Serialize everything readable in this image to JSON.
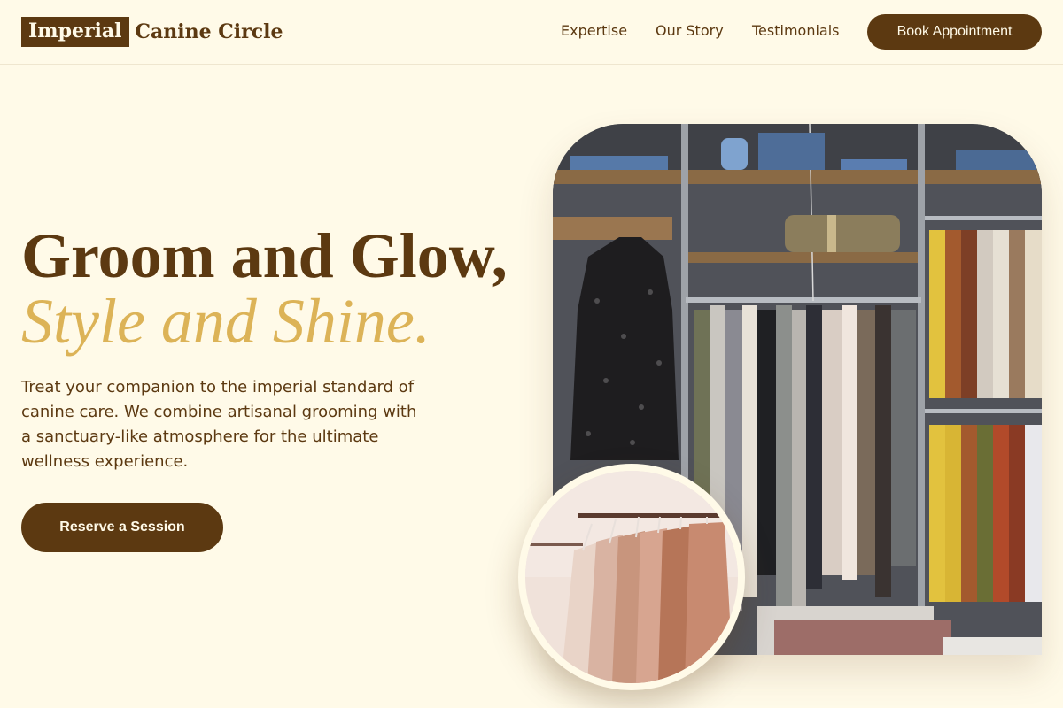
{
  "brand": {
    "highlight": "Imperial",
    "rest": "Canine Circle"
  },
  "nav": {
    "items": [
      "Expertise",
      "Our Story",
      "Testimonials"
    ],
    "cta_label": "Book Appointment"
  },
  "hero": {
    "title_line1": "Groom and Glow,",
    "title_line2": "Style and Shine.",
    "description": "Treat your companion to the imperial standard of canine care. We combine artisanal grooming with a sanctuary-like atmosphere for the ultimate wellness experience.",
    "cta_label": "Reserve a Session"
  },
  "colors": {
    "background": "#fffae8",
    "brand_brown": "#5c3911",
    "accent_gold": "#dcb357"
  }
}
